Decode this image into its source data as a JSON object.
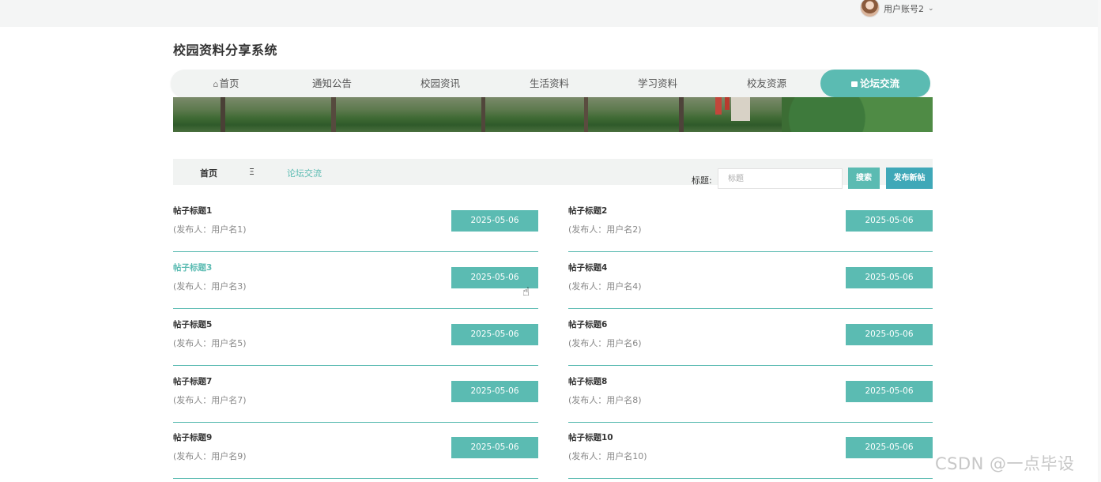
{
  "user": {
    "account": "用户账号2"
  },
  "site": {
    "title": "校园资料分享系统"
  },
  "nav": {
    "items": [
      {
        "label": "首页"
      },
      {
        "label": "通知公告"
      },
      {
        "label": "校园资讯"
      },
      {
        "label": "生活资料"
      },
      {
        "label": "学习资料"
      },
      {
        "label": "校友资源"
      },
      {
        "label": "论坛交流"
      }
    ],
    "active": "论坛交流"
  },
  "breadcrumb": {
    "home": "首页",
    "separator": "Ξ",
    "current": "论坛交流"
  },
  "search": {
    "label": "标题:",
    "placeholder": "标题",
    "search_button": "搜索",
    "new_post_button": "发布新帖"
  },
  "posts": [
    {
      "title": "帖子标题1",
      "author": "(发布人：用户名1)",
      "date": "2025-05-06 11:01:23"
    },
    {
      "title": "帖子标题2",
      "author": "(发布人：用户名2)",
      "date": "2025-05-06 11:01:23"
    },
    {
      "title": "帖子标题3",
      "author": "(发布人：用户名3)",
      "date": "2025-05-06 11:01:23"
    },
    {
      "title": "帖子标题4",
      "author": "(发布人：用户名4)",
      "date": "2025-05-06 11:01:23"
    },
    {
      "title": "帖子标题5",
      "author": "(发布人：用户名5)",
      "date": "2025-05-06 11:01:23"
    },
    {
      "title": "帖子标题6",
      "author": "(发布人：用户名6)",
      "date": "2025-05-06 11:01:23"
    },
    {
      "title": "帖子标题7",
      "author": "(发布人：用户名7)",
      "date": "2025-05-06 11:01:23"
    },
    {
      "title": "帖子标题8",
      "author": "(发布人：用户名8)",
      "date": "2025-05-06 11:01:23"
    },
    {
      "title": "帖子标题9",
      "author": "(发布人：用户名9)",
      "date": "2025-05-06 11:01:23"
    },
    {
      "title": "帖子标题10",
      "author": "(发布人：用户名10)",
      "date": "2025-05-06 11:01:23"
    }
  ],
  "watermark": "CSDN @一点毕设",
  "colors": {
    "accent": "#5bbbb2",
    "accent_dark": "#3fa8b8",
    "nav_bg": "#f1f3f2",
    "topbar_bg": "#f4f5f5"
  },
  "icons": {
    "home": "home-icon",
    "message": "message-icon",
    "chevron": "chevron-down-icon",
    "cursor": "hand-cursor-icon"
  }
}
